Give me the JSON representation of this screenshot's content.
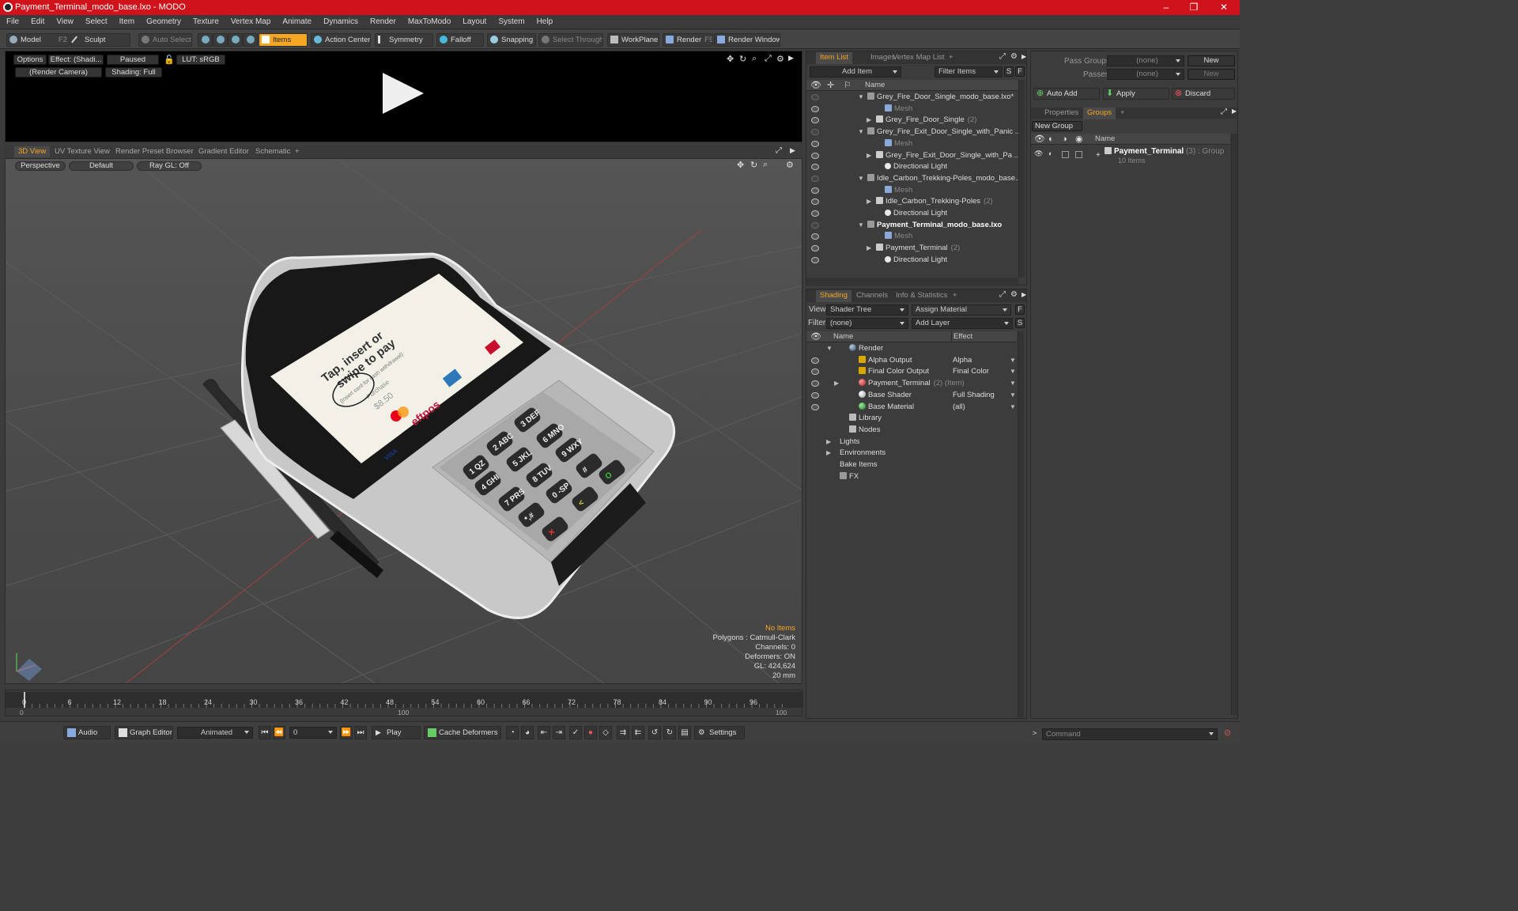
{
  "window": {
    "title": "Payment_Terminal_modo_base.lxo - MODO",
    "minimize": "–",
    "maximize": "❐",
    "close": "✕"
  },
  "menu": [
    "File",
    "Edit",
    "View",
    "Select",
    "Item",
    "Geometry",
    "Texture",
    "Vertex Map",
    "Animate",
    "Dynamics",
    "Render",
    "MaxToModo",
    "Layout",
    "System",
    "Help"
  ],
  "toolbar": {
    "model": "Model",
    "model_key": "F2",
    "sculpt": "Sculpt",
    "auto_select": "Auto Select",
    "items": "Items",
    "action_center": "Action Center",
    "symmetry": "Symmetry",
    "falloff": "Falloff",
    "snapping": "Snapping",
    "select_through": "Select Through",
    "workplane": "WorkPlane",
    "render": "Render",
    "render_key": "F9",
    "render_window": "Render Window"
  },
  "preview": {
    "options": "Options",
    "effect": "Effect: (Shadi...",
    "paused": "Paused",
    "lut": "LUT: sRGB",
    "camera": "(Render Camera)",
    "shading": "Shading: Full"
  },
  "viewport_tabs": [
    "3D View",
    "UV Texture View",
    "Render Preset Browser",
    "Gradient Editor",
    "Schematic",
    "+"
  ],
  "viewport": {
    "perspective": "Perspective",
    "default": "Default",
    "raygl": "Ray GL: Off",
    "info": {
      "no_items": "No Items",
      "polygons": "Polygons : Catmull-Clark",
      "channels": "Channels: 0",
      "deformers": "Deformers: ON",
      "gl": "GL: 424,624",
      "size": "20 mm"
    },
    "screen_lines": [
      "Tap, insert or",
      "swipe to pay",
      "(Insert card for cash withdrawal)",
      "Purchase",
      "$8.50"
    ],
    "brands": {
      "visa": "VISA",
      "eftpos": "eftpos"
    },
    "keys": [
      "1 QZ",
      "2 ABC",
      "3 DEF",
      "4 GHI",
      "5 JKL",
      "6 MNO",
      "7 PRS",
      "8 TUV",
      "9 WXY",
      "*,#",
      "0 -SP",
      "#",
      "✕",
      "<",
      "O"
    ]
  },
  "timeline": {
    "ticks": [
      "0",
      "6",
      "12",
      "18",
      "24",
      "30",
      "36",
      "42",
      "48",
      "54",
      "60",
      "66",
      "72",
      "78",
      "84",
      "90",
      "96"
    ],
    "start": "0",
    "mid": "100",
    "end": "100"
  },
  "bottom": {
    "audio": "Audio",
    "graph_editor": "Graph Editor",
    "animated": "Animated",
    "frame": "0",
    "play": "Play",
    "cache": "Cache Deformers",
    "settings": "Settings",
    "command": "Command"
  },
  "item_list": {
    "tabs": [
      "Item List",
      "Images",
      "Vertex Map List",
      "+"
    ],
    "add_item": "Add Item",
    "filter": "Filter Items",
    "s": "S",
    "f": "F",
    "name_col": "Name",
    "rows": [
      {
        "label": "Grey_Fire_Door_Single_modo_base.lxo*",
        "suffix": "",
        "indent": 1,
        "type": "scene",
        "bold": false,
        "gray": false
      },
      {
        "label": "Mesh",
        "suffix": "",
        "indent": 3,
        "type": "mesh",
        "bold": false,
        "gray": true
      },
      {
        "label": "Grey_Fire_Door_Single",
        "suffix": "(2)",
        "indent": 2,
        "type": "loc",
        "bold": false,
        "gray": false
      },
      {
        "label": "Grey_Fire_Exit_Door_Single_with_Panic ...",
        "suffix": "",
        "indent": 1,
        "type": "scene",
        "bold": false,
        "gray": false
      },
      {
        "label": "Mesh",
        "suffix": "",
        "indent": 3,
        "type": "mesh",
        "bold": false,
        "gray": true
      },
      {
        "label": "Grey_Fire_Exit_Door_Single_with_Pa ...",
        "suffix": "",
        "indent": 2,
        "type": "loc",
        "bold": false,
        "gray": false
      },
      {
        "label": "Directional Light",
        "suffix": "",
        "indent": 3,
        "type": "light",
        "bold": false,
        "gray": false
      },
      {
        "label": "Idle_Carbon_Trekking-Poles_modo_base...",
        "suffix": "",
        "indent": 1,
        "type": "scene",
        "bold": false,
        "gray": false
      },
      {
        "label": "Mesh",
        "suffix": "",
        "indent": 3,
        "type": "mesh",
        "bold": false,
        "gray": true
      },
      {
        "label": "Idle_Carbon_Trekking-Poles",
        "suffix": "(2)",
        "indent": 2,
        "type": "loc",
        "bold": false,
        "gray": false
      },
      {
        "label": "Directional Light",
        "suffix": "",
        "indent": 3,
        "type": "light",
        "bold": false,
        "gray": false
      },
      {
        "label": "Payment_Terminal_modo_base.lxo",
        "suffix": "",
        "indent": 1,
        "type": "scene",
        "bold": true,
        "gray": false
      },
      {
        "label": "Mesh",
        "suffix": "",
        "indent": 3,
        "type": "mesh",
        "bold": false,
        "gray": true
      },
      {
        "label": "Payment_Terminal",
        "suffix": "(2)",
        "indent": 2,
        "type": "loc",
        "bold": false,
        "gray": false
      },
      {
        "label": "Directional Light",
        "suffix": "",
        "indent": 3,
        "type": "light",
        "bold": false,
        "gray": false
      }
    ]
  },
  "shading": {
    "tabs": [
      "Shading",
      "Channels",
      "Info & Statistics",
      "+"
    ],
    "view_label": "View",
    "view_value": "Shader Tree",
    "assign_material": "Assign Material",
    "f": "F",
    "filter_label": "Filter",
    "filter_value": "(none)",
    "add_layer": "Add Layer",
    "s": "S",
    "name_col": "Name",
    "effect_col": "Effect",
    "rows": [
      {
        "label": "Render",
        "suffix": "",
        "effect": "",
        "indent": 1,
        "icon": "blue",
        "eye": false
      },
      {
        "label": "Alpha Output",
        "suffix": "",
        "effect": "Alpha",
        "indent": 2,
        "icon": "out",
        "eye": true
      },
      {
        "label": "Final Color Output",
        "suffix": "",
        "effect": "Final Color",
        "indent": 2,
        "icon": "out",
        "eye": true
      },
      {
        "label": "Payment_Terminal",
        "suffix": "(2) (Item)",
        "effect": "",
        "indent": 2,
        "icon": "red",
        "eye": true
      },
      {
        "label": "Base Shader",
        "suffix": "",
        "effect": "Full Shading",
        "indent": 2,
        "icon": "sphere",
        "eye": true
      },
      {
        "label": "Base Material",
        "suffix": "",
        "effect": "(all)",
        "indent": 2,
        "icon": "green",
        "eye": true
      },
      {
        "label": "Library",
        "suffix": "",
        "effect": "",
        "indent": 1,
        "icon": "folder",
        "eye": false
      },
      {
        "label": "Nodes",
        "suffix": "",
        "effect": "",
        "indent": 1,
        "icon": "folder",
        "eye": false
      },
      {
        "label": "Lights",
        "suffix": "",
        "effect": "",
        "indent": 0,
        "icon": "",
        "eye": false
      },
      {
        "label": "Environments",
        "suffix": "",
        "effect": "",
        "indent": 0,
        "icon": "",
        "eye": false
      },
      {
        "label": "Bake Items",
        "suffix": "",
        "effect": "",
        "indent": 0,
        "icon": "",
        "eye": false
      },
      {
        "label": "FX",
        "suffix": "",
        "effect": "",
        "indent": 0,
        "icon": "scene",
        "eye": false
      }
    ]
  },
  "right": {
    "pass_groups": "Pass Groups",
    "passes": "Passes",
    "none": "(none)",
    "new": "New",
    "auto_add": "Auto Add",
    "apply": "Apply",
    "discard": "Discard",
    "tabs": [
      "Properties",
      "Groups",
      "+"
    ],
    "new_group": "New Group",
    "name_col": "Name",
    "group_name": "Payment_Terminal",
    "group_suffix": "(3) : Group",
    "group_items": "10 Items"
  }
}
